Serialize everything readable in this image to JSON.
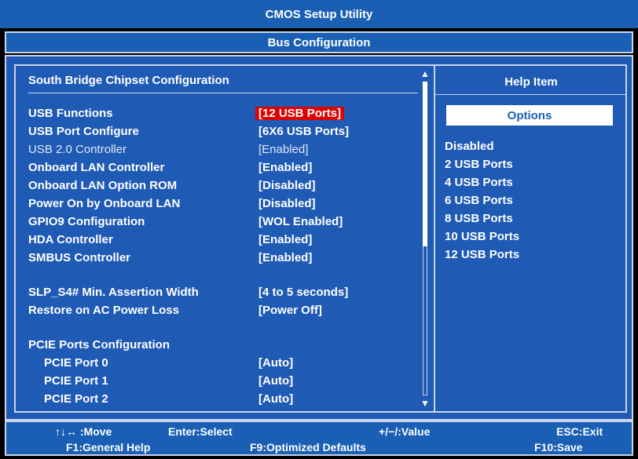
{
  "window": {
    "title": "CMOS Setup Utility",
    "subtitle": "Bus Configuration"
  },
  "left": {
    "section_title": "South Bridge Chipset Configuration",
    "rows": [
      {
        "label": "USB Functions",
        "value": "[12 USB Ports]",
        "selected": true
      },
      {
        "label": "USB Port Configure",
        "value": "[6X6 USB Ports]"
      },
      {
        "label": "USB 2.0 Controller",
        "value": "[Enabled]",
        "disabled": true
      },
      {
        "label": "Onboard LAN Controller",
        "value": "[Enabled]"
      },
      {
        "label": "Onboard LAN Option ROM",
        "value": "[Disabled]"
      },
      {
        "label": "Power On by Onboard LAN",
        "value": "[Disabled]"
      },
      {
        "label": "GPIO9 Configuration",
        "value": "[WOL Enabled]"
      },
      {
        "label": "HDA Controller",
        "value": "[Enabled]"
      },
      {
        "label": "SMBUS Controller",
        "value": "[Enabled]"
      },
      {
        "label": "SLP_S4# Min. Assertion Width",
        "value": "[4 to 5 seconds]"
      },
      {
        "label": "Restore on AC Power Loss",
        "value": "[Power Off]"
      },
      {
        "label": "PCIE Ports Configuration",
        "value": ""
      },
      {
        "label": "PCIE Port 0",
        "value": "[Auto]",
        "indent": true
      },
      {
        "label": "PCIE Port 1",
        "value": "[Auto]",
        "indent": true
      },
      {
        "label": "PCIE Port 2",
        "value": "[Auto]",
        "indent": true
      }
    ]
  },
  "right": {
    "help_title": "Help Item",
    "options_label": "Options",
    "options": [
      "Disabled",
      "2 USB Ports",
      "4 USB Ports",
      "6 USB Ports",
      "8 USB Ports",
      "10 USB Ports",
      "12 USB Ports"
    ]
  },
  "footer": {
    "move": "↑↓↔ :Move",
    "enter": "Enter:Select",
    "value": "+/−/:Value",
    "esc": "ESC:Exit",
    "f1": "F1:General Help",
    "f9": "F9:Optimized Defaults",
    "f10": "F10:Save"
  },
  "colors": {
    "accent": "#1a5fb4",
    "panel": "#1f5ab4",
    "selected": "#e00000"
  }
}
